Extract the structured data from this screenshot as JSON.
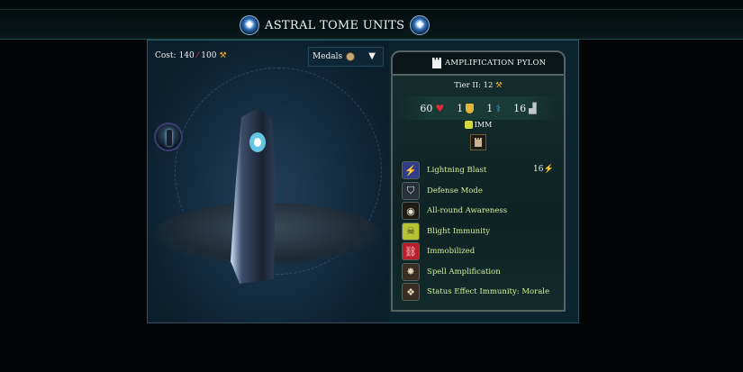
{
  "header": {
    "title": "ASTRAL TOME UNITS"
  },
  "unit_view": {
    "cost_label": "Cost:",
    "cost_mana": "140",
    "cost_gold": "100",
    "medals_select": {
      "label": "Medals",
      "caret": "▼"
    }
  },
  "card": {
    "name": "AMPLIFICATION PYLON",
    "tier": "Tier II: 12",
    "stats": {
      "hp": "60",
      "defense": "1",
      "resistance": "1",
      "movement": "16"
    },
    "immunity_tag": "IMM",
    "abilities": [
      {
        "label": "Lightning Blast",
        "value": "16",
        "icon": "lightning-blast-icon",
        "color": "#2f3c8a"
      },
      {
        "label": "Defense Mode",
        "icon": "shield-icon",
        "color": "#2a3038"
      },
      {
        "label": "All-round Awareness",
        "icon": "eye-icon",
        "color": "#1e1a14"
      },
      {
        "label": "Blight Immunity",
        "icon": "skull-icon",
        "color": "#b8c235"
      },
      {
        "label": "Immobilized",
        "icon": "chain-icon",
        "color": "#b81f2a"
      },
      {
        "label": "Spell Amplification",
        "icon": "burst-icon",
        "color": "#3a2e24"
      },
      {
        "label": "Status Effect Immunity: Morale",
        "icon": "mask-icon",
        "color": "#3a2e24"
      }
    ]
  },
  "colors": {
    "accent_green": "#d4ef9c",
    "gold": "#f0b22a",
    "panel_bg": "#0c2330"
  }
}
